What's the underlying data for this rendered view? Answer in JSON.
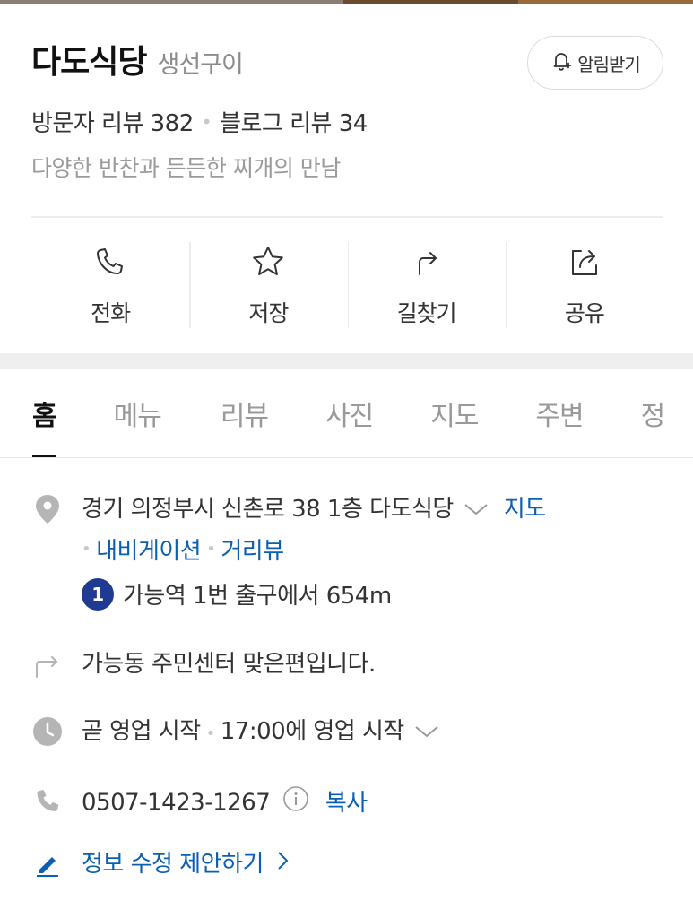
{
  "place": {
    "name": "다도식당",
    "category": "생선구이",
    "notify_label": "알림받기",
    "visitor_reviews": "방문자 리뷰 382",
    "blog_reviews": "블로그 리뷰 34",
    "description": "다양한 반찬과 든든한 찌개의 만남"
  },
  "actions": [
    {
      "label": "전화",
      "icon": "phone-icon"
    },
    {
      "label": "저장",
      "icon": "star-icon"
    },
    {
      "label": "길찾기",
      "icon": "directions-icon"
    },
    {
      "label": "공유",
      "icon": "share-icon"
    }
  ],
  "tabs": [
    "홈",
    "메뉴",
    "리뷰",
    "사진",
    "지도",
    "주변",
    "정"
  ],
  "active_tab": "홈",
  "info": {
    "address": "경기 의정부시 신촌로 38 1층 다도식당",
    "map_link": "지도",
    "navigation_link": "내비게이션",
    "streetview_link": "거리뷰",
    "station_number": "1",
    "station_text": "가능역 1번 출구에서 654m",
    "directions_text": "가능동 주민센터 맞은편입니다.",
    "hours_status": "곧 영업 시작",
    "hours_detail": "17:00에 영업 시작",
    "phone": "0507-1423-1267",
    "copy_label": "복사",
    "suggest_edit": "정보 수정 제안하기"
  },
  "colors": {
    "link": "#0b5fb3",
    "station_badge": "#1f3a93",
    "muted": "#999999",
    "icon_gray": "#b5b5b5"
  }
}
